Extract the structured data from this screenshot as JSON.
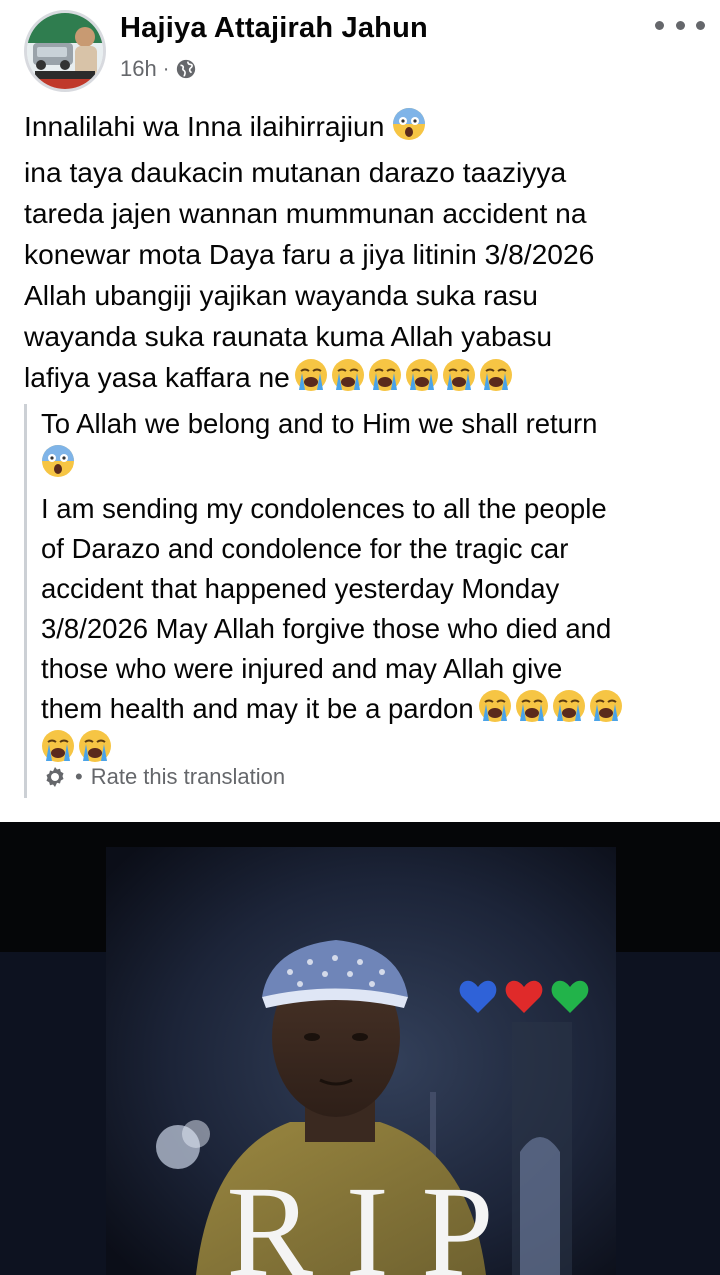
{
  "post": {
    "author": "Hajiya Attajirah Jahun",
    "time": "16h",
    "separator": "·",
    "privacy_icon": "globe-icon",
    "more_icon": "more-horizontal-icon",
    "original_lines": [
      "Innalilahi wa Inna ilaihirrajiun",
      "ina taya daukacin mutanan darazo taaziyya",
      "tareda jajen wannan mummunan accident na",
      "konewar mota Daya faru a jiya litinin 3/8/2026",
      "Allah ubangiji yajikan wayanda suka rasu",
      "wayanda suka raunata kuma Allah yabasu",
      "lafiya yasa kaffara ne"
    ],
    "translation_lines": [
      "To Allah we belong and to Him we shall return",
      "",
      "I am sending my condolences to all the people",
      "of Darazo and condolence for the tragic car",
      "accident that happened yesterday Monday",
      "3/8/2026 May Allah forgive those who died and",
      "those who were injured and may Allah give",
      "them health and may it be a pardon",
      ""
    ],
    "rate_label": "Rate this translation",
    "rate_dot": "•",
    "photo_caption": "RIP"
  },
  "colors": {
    "text": "#050505",
    "secondary": "#65676b",
    "quote_border": "#ccd0d5",
    "photo_bg": "#0a0c14"
  }
}
